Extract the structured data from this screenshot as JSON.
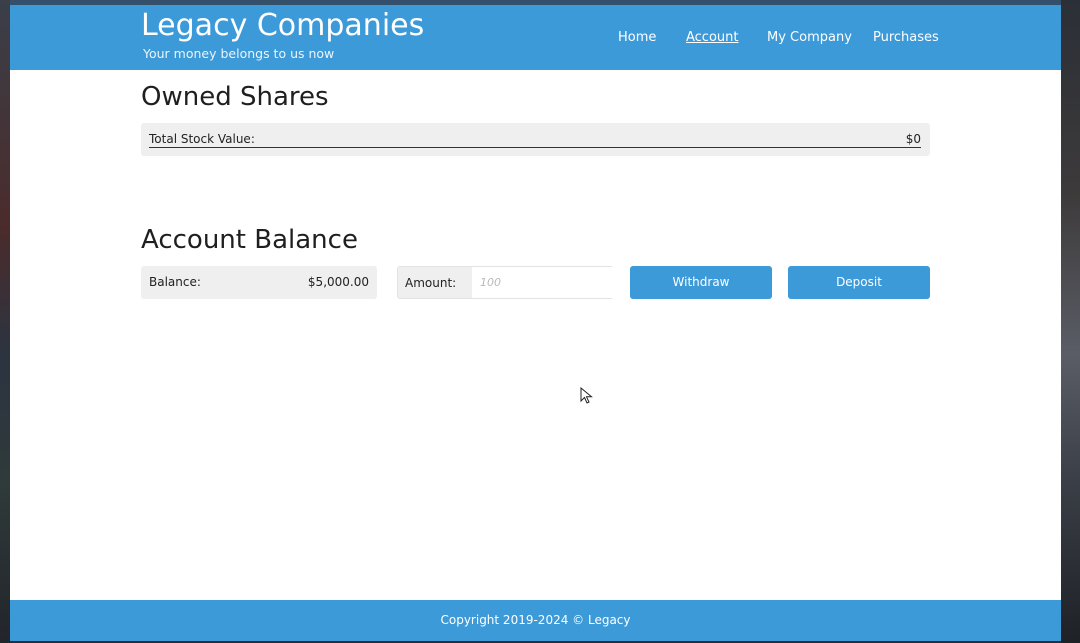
{
  "header": {
    "title": "Legacy Companies",
    "tagline": "Your money belongs to us now",
    "nav": [
      {
        "label": "Home"
      },
      {
        "label": "Account"
      },
      {
        "label": "My Company"
      },
      {
        "label": "Purchases"
      }
    ],
    "active_nav": "Account"
  },
  "owned_shares": {
    "title": "Owned Shares",
    "total_label": "Total Stock Value:",
    "total_value": "$0"
  },
  "account_balance": {
    "title": "Account Balance",
    "balance_label": "Balance:",
    "balance_value": "$5,000.00",
    "amount_label": "Amount:",
    "amount_value": "",
    "amount_placeholder": "100",
    "withdraw_label": "Withdraw",
    "deposit_label": "Deposit"
  },
  "footer": {
    "copyright": "Copyright 2019-2024 © Legacy"
  },
  "colors": {
    "accent": "#3d9ad9",
    "panel": "#efefef"
  },
  "icons": {
    "cursor": "mouse-pointer-icon"
  }
}
